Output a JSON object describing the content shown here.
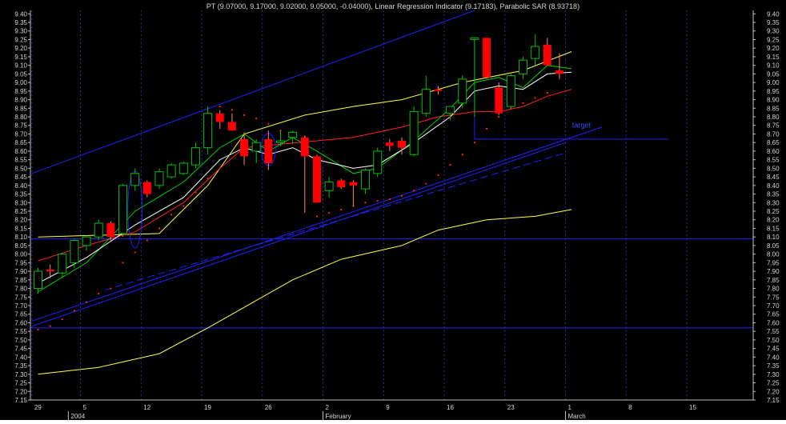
{
  "header": {
    "text": "PT (9.07000, 9.17000, 9.02000, 9.05000, -0.04000), Linear Regression Indicator (9.17183), Parabolic SAR (8.93718)"
  },
  "annotation": {
    "target_label": "target"
  },
  "colors": {
    "background": "#000000",
    "up_candle": "#00c000",
    "down_candle": "#ff0000",
    "trend_line": "#2020ff",
    "ma_yellow": "#ffff40",
    "ma_white": "#ffffff",
    "ma_green": "#00d000",
    "ma_red": "#ff2020",
    "sar_dots": "#ff2020",
    "grid": "#3030a0"
  },
  "chart_data": {
    "type": "candlestick",
    "title": "PT",
    "ylim": [
      7.15,
      9.42
    ],
    "y_ticks": [
      "9.40",
      "9.35",
      "9.30",
      "9.25",
      "9.20",
      "9.15",
      "9.10",
      "9.05",
      "9.00",
      "8.95",
      "8.90",
      "8.85",
      "8.80",
      "8.75",
      "8.70",
      "8.65",
      "8.60",
      "8.55",
      "8.50",
      "8.45",
      "8.40",
      "8.35",
      "8.30",
      "8.25",
      "8.20",
      "8.15",
      "8.10",
      "8.05",
      "8.00",
      "7.95",
      "7.90",
      "7.85",
      "7.80",
      "7.75",
      "7.70",
      "7.65",
      "7.60",
      "7.55",
      "7.50",
      "7.45",
      "7.40",
      "7.35",
      "7.30",
      "7.25",
      "7.20",
      "7.15"
    ],
    "x_ticks": [
      {
        "label": "29",
        "bar": 0
      },
      {
        "label": "5",
        "bar": 4
      },
      {
        "label": "12",
        "bar": 9
      },
      {
        "label": "19",
        "bar": 14
      },
      {
        "label": "26",
        "bar": 19
      },
      {
        "label": "2",
        "bar": 24
      },
      {
        "label": "9",
        "bar": 29
      },
      {
        "label": "16",
        "bar": 34
      },
      {
        "label": "23",
        "bar": 39
      },
      {
        "label": "1",
        "bar": 44
      },
      {
        "label": "8",
        "bar": 49
      },
      {
        "label": "15",
        "bar": 54
      }
    ],
    "x_sublabels": [
      {
        "label": "2004",
        "bar": 3
      },
      {
        "label": "February",
        "bar": 24
      },
      {
        "label": "March",
        "bar": 44
      }
    ],
    "candles": [
      {
        "o": 7.8,
        "h": 7.92,
        "l": 7.77,
        "c": 7.9
      },
      {
        "o": 7.91,
        "h": 7.94,
        "l": 7.86,
        "c": 7.9
      },
      {
        "o": 7.89,
        "h": 8.01,
        "l": 7.86,
        "c": 8.0
      },
      {
        "o": 7.95,
        "h": 8.09,
        "l": 7.92,
        "c": 8.08
      },
      {
        "o": 8.05,
        "h": 8.11,
        "l": 8.02,
        "c": 8.1
      },
      {
        "o": 8.1,
        "h": 8.2,
        "l": 8.08,
        "c": 8.18
      },
      {
        "o": 8.18,
        "h": 8.19,
        "l": 8.08,
        "c": 8.1
      },
      {
        "o": 8.12,
        "h": 8.41,
        "l": 8.1,
        "c": 8.4
      },
      {
        "o": 8.4,
        "h": 8.5,
        "l": 8.37,
        "c": 8.47
      },
      {
        "o": 8.42,
        "h": 8.43,
        "l": 8.33,
        "c": 8.35
      },
      {
        "o": 8.4,
        "h": 8.5,
        "l": 8.38,
        "c": 8.48
      },
      {
        "o": 8.45,
        "h": 8.53,
        "l": 8.44,
        "c": 8.52
      },
      {
        "o": 8.47,
        "h": 8.54,
        "l": 8.46,
        "c": 8.53
      },
      {
        "o": 8.52,
        "h": 8.65,
        "l": 8.5,
        "c": 8.62
      },
      {
        "o": 8.62,
        "h": 8.86,
        "l": 8.58,
        "c": 8.82
      },
      {
        "o": 8.82,
        "h": 8.84,
        "l": 8.73,
        "c": 8.77
      },
      {
        "o": 8.77,
        "h": 8.82,
        "l": 8.72,
        "c": 8.72
      },
      {
        "o": 8.67,
        "h": 8.71,
        "l": 8.52,
        "c": 8.57
      },
      {
        "o": 8.6,
        "h": 8.67,
        "l": 8.53,
        "c": 8.65
      },
      {
        "o": 8.67,
        "h": 8.72,
        "l": 8.49,
        "c": 8.53
      },
      {
        "o": 8.65,
        "h": 8.72,
        "l": 8.63,
        "c": 8.66
      },
      {
        "o": 8.68,
        "h": 8.72,
        "l": 8.64,
        "c": 8.71
      },
      {
        "o": 8.68,
        "h": 8.69,
        "l": 8.24,
        "c": 8.57
      },
      {
        "o": 8.57,
        "h": 8.58,
        "l": 8.3,
        "c": 8.3
      },
      {
        "o": 8.37,
        "h": 8.45,
        "l": 8.33,
        "c": 8.42
      },
      {
        "o": 8.43,
        "h": 8.44,
        "l": 8.38,
        "c": 8.39
      },
      {
        "o": 8.42,
        "h": 8.43,
        "l": 8.28,
        "c": 8.4
      },
      {
        "o": 8.38,
        "h": 8.5,
        "l": 8.35,
        "c": 8.49
      },
      {
        "o": 8.47,
        "h": 8.62,
        "l": 8.45,
        "c": 8.6
      },
      {
        "o": 8.65,
        "h": 8.67,
        "l": 8.6,
        "c": 8.63
      },
      {
        "o": 8.66,
        "h": 8.68,
        "l": 8.58,
        "c": 8.62
      },
      {
        "o": 8.58,
        "h": 8.86,
        "l": 8.57,
        "c": 8.83
      },
      {
        "o": 8.82,
        "h": 9.04,
        "l": 8.8,
        "c": 8.96
      },
      {
        "o": 8.96,
        "h": 8.98,
        "l": 8.93,
        "c": 8.95
      },
      {
        "o": 8.82,
        "h": 8.86,
        "l": 8.78,
        "c": 8.86
      },
      {
        "o": 8.88,
        "h": 9.04,
        "l": 8.85,
        "c": 9.02
      },
      {
        "o": 9.26,
        "h": 9.26,
        "l": 8.8,
        "c": 9.26
      },
      {
        "o": 9.26,
        "h": 9.26,
        "l": 9.03,
        "c": 9.03
      },
      {
        "o": 8.97,
        "h": 9.0,
        "l": 8.81,
        "c": 8.82
      },
      {
        "o": 8.86,
        "h": 9.05,
        "l": 8.85,
        "c": 9.04
      },
      {
        "o": 9.05,
        "h": 9.15,
        "l": 9.02,
        "c": 9.13
      },
      {
        "o": 9.14,
        "h": 9.28,
        "l": 9.1,
        "c": 9.21
      },
      {
        "o": 9.22,
        "h": 9.26,
        "l": 9.1,
        "c": 9.1
      },
      {
        "o": 9.07,
        "h": 9.17,
        "l": 9.02,
        "c": 9.05
      }
    ],
    "ma_yellow": [
      [
        0,
        8.1
      ],
      [
        10,
        8.12
      ],
      [
        14,
        8.4
      ],
      [
        17,
        8.7
      ],
      [
        22,
        8.81
      ],
      [
        26,
        8.86
      ],
      [
        30,
        8.9
      ],
      [
        35,
        9.0
      ],
      [
        40,
        9.07
      ],
      [
        44,
        9.18
      ]
    ],
    "ma_white": [
      [
        0,
        7.83
      ],
      [
        4,
        7.98
      ],
      [
        8,
        8.17
      ],
      [
        12,
        8.33
      ],
      [
        15,
        8.55
      ],
      [
        17,
        8.62
      ],
      [
        19,
        8.58
      ],
      [
        21,
        8.62
      ],
      [
        23,
        8.55
      ],
      [
        26,
        8.5
      ],
      [
        28,
        8.52
      ],
      [
        31,
        8.65
      ],
      [
        34,
        8.8
      ],
      [
        36,
        8.95
      ],
      [
        38,
        8.98
      ],
      [
        40,
        8.96
      ],
      [
        42,
        9.05
      ],
      [
        44,
        9.06
      ]
    ],
    "ma_green": [
      [
        0,
        7.78
      ],
      [
        4,
        7.95
      ],
      [
        8,
        8.25
      ],
      [
        12,
        8.42
      ],
      [
        15,
        8.62
      ],
      [
        17,
        8.7
      ],
      [
        19,
        8.6
      ],
      [
        21,
        8.68
      ],
      [
        23,
        8.6
      ],
      [
        26,
        8.47
      ],
      [
        28,
        8.5
      ],
      [
        31,
        8.66
      ],
      [
        34,
        8.85
      ],
      [
        36,
        9.0
      ],
      [
        38,
        9.03
      ],
      [
        40,
        8.97
      ],
      [
        42,
        9.1
      ],
      [
        44,
        9.08
      ]
    ],
    "ma_red": [
      [
        0,
        7.96
      ],
      [
        4,
        8.05
      ],
      [
        8,
        8.13
      ],
      [
        12,
        8.3
      ],
      [
        15,
        8.5
      ],
      [
        17,
        8.62
      ],
      [
        20,
        8.64
      ],
      [
        23,
        8.66
      ],
      [
        26,
        8.68
      ],
      [
        30,
        8.74
      ],
      [
        33,
        8.8
      ],
      [
        36,
        8.83
      ],
      [
        38,
        8.83
      ],
      [
        40,
        8.86
      ],
      [
        42,
        8.92
      ],
      [
        44,
        8.96
      ]
    ],
    "ma_long_yellow": [
      [
        0,
        7.3
      ],
      [
        5,
        7.34
      ],
      [
        10,
        7.42
      ],
      [
        14,
        7.57
      ],
      [
        18,
        7.73
      ],
      [
        21,
        7.85
      ],
      [
        25,
        7.97
      ],
      [
        30,
        8.05
      ],
      [
        33,
        8.14
      ],
      [
        37,
        8.2
      ],
      [
        41,
        8.22
      ],
      [
        44,
        8.26
      ]
    ],
    "sar": [
      [
        0,
        7.56
      ],
      [
        1,
        7.58
      ],
      [
        2,
        7.62
      ],
      [
        3,
        7.67
      ],
      [
        4,
        7.72
      ],
      [
        5,
        7.77
      ],
      [
        6,
        7.8
      ],
      [
        7,
        7.95
      ],
      [
        8,
        8.01
      ],
      [
        9,
        8.08
      ],
      [
        10,
        8.15
      ],
      [
        11,
        8.23
      ],
      [
        12,
        8.28
      ],
      [
        13,
        8.36
      ],
      [
        14,
        8.44
      ],
      [
        15,
        8.86
      ],
      [
        16,
        8.84
      ],
      [
        17,
        8.81
      ],
      [
        18,
        8.79
      ],
      [
        19,
        8.76
      ],
      [
        20,
        8.72
      ],
      [
        21,
        8.71
      ],
      [
        22,
        8.68
      ],
      [
        23,
        8.22
      ],
      [
        24,
        8.24
      ],
      [
        25,
        8.26
      ],
      [
        26,
        8.28
      ],
      [
        27,
        8.3
      ],
      [
        28,
        8.31
      ],
      [
        29,
        8.32
      ],
      [
        30,
        8.34
      ],
      [
        31,
        8.37
      ],
      [
        32,
        8.41
      ],
      [
        33,
        8.46
      ],
      [
        34,
        8.52
      ],
      [
        35,
        8.58
      ],
      [
        36,
        8.65
      ],
      [
        37,
        8.73
      ],
      [
        38,
        8.8
      ],
      [
        39,
        8.85
      ],
      [
        40,
        8.88
      ],
      [
        41,
        8.91
      ],
      [
        42,
        8.94
      ]
    ],
    "hlines": [
      8.09,
      7.57
    ],
    "trendlines": [
      {
        "x1": -0.5,
        "y1": 8.47,
        "x2": 36,
        "y2": 9.42,
        "dashed": false
      },
      {
        "x1": -0.5,
        "y1": 7.61,
        "x2": 46.5,
        "y2": 8.74,
        "dashed": false
      },
      {
        "x1": -0.5,
        "y1": 7.58,
        "x2": 43.5,
        "y2": 8.65,
        "dashed": false
      },
      {
        "x1": 5.5,
        "y1": 7.79,
        "x2": 43.5,
        "y2": 8.59,
        "dashed": true
      }
    ],
    "target": {
      "x1": 36,
      "x2": 52,
      "y": 8.67,
      "label_y": 8.75
    }
  }
}
